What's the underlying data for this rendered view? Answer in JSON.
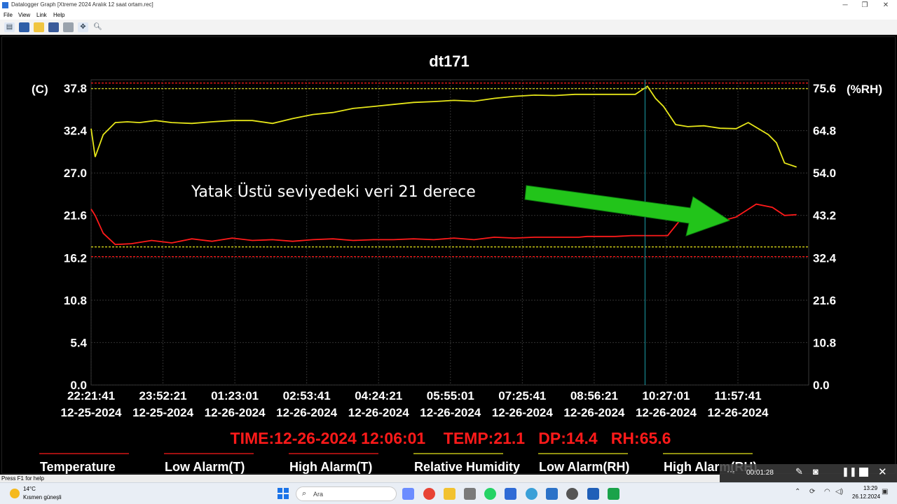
{
  "window": {
    "title": "Datalogger Graph [Xtreme 2024 Aralık 12 saat ortam.rec]",
    "minimize_glyph": "─",
    "maximize_glyph": "❐",
    "close_glyph": "✕"
  },
  "menu": [
    "File",
    "View",
    "Link",
    "Help"
  ],
  "toolbar_icons": [
    "new-icon",
    "screen-icon",
    "open-icon",
    "save-icon",
    "print-icon",
    "fit-icon",
    "zoom-icon"
  ],
  "annotation": {
    "text": "Yatak Üstü seviyedeki veri 21 derece",
    "arrow_color": "#22c41a"
  },
  "chart_data": {
    "type": "line",
    "title": "dt171",
    "left_axis_unit": "(C)",
    "right_axis_unit": "(%RH)",
    "left_ticks": [
      "37.8",
      "32.4",
      "27.0",
      "21.6",
      "16.2",
      "10.8",
      "5.4",
      "0.0"
    ],
    "right_ticks": [
      "75.6",
      "64.8",
      "54.0",
      "43.2",
      "32.4",
      "21.6",
      "10.8",
      "0.0"
    ],
    "x_ticks": [
      {
        "time": "22:21:41",
        "date": "12-25-2024"
      },
      {
        "time": "23:52:21",
        "date": "12-25-2024"
      },
      {
        "time": "01:23:01",
        "date": "12-26-2024"
      },
      {
        "time": "02:53:41",
        "date": "12-26-2024"
      },
      {
        "time": "04:24:21",
        "date": "12-26-2024"
      },
      {
        "time": "05:55:01",
        "date": "12-26-2024"
      },
      {
        "time": "07:25:41",
        "date": "12-26-2024"
      },
      {
        "time": "08:56:21",
        "date": "12-26-2024"
      },
      {
        "time": "10:27:01",
        "date": "12-26-2024"
      },
      {
        "time": "11:57:41",
        "date": "12-26-2024"
      }
    ],
    "ylim_left": [
      0,
      37.8
    ],
    "ylim_right": [
      0,
      75.6
    ],
    "grid": true,
    "series": [
      {
        "name": "Temperature",
        "axis": "left",
        "color": "#ff1a1a",
        "x_hours": [
          0,
          0.1,
          0.3,
          0.6,
          1.0,
          1.5,
          2.0,
          2.5,
          3.0,
          3.5,
          4.0,
          4.5,
          5.0,
          5.5,
          6.0,
          6.5,
          7.0,
          7.5,
          8.0,
          8.5,
          9.0,
          9.5,
          10.0,
          10.5,
          11.0,
          11.5,
          12.0,
          12.1,
          12.3,
          12.6,
          13.0,
          13.4,
          13.8,
          14.3,
          14.8,
          15.2,
          15.5,
          15.7,
          16.0,
          16.5,
          16.9,
          17.2,
          17.5
        ],
        "values": [
          21.8,
          21.0,
          18.8,
          17.4,
          17.5,
          17.9,
          17.6,
          18.1,
          17.8,
          18.2,
          17.9,
          18.0,
          17.8,
          18.0,
          18.1,
          17.9,
          18.0,
          18.0,
          18.1,
          18.0,
          18.2,
          18.0,
          18.3,
          18.2,
          18.3,
          18.3,
          18.3,
          18.3,
          18.4,
          18.4,
          18.4,
          18.5,
          18.5,
          18.5,
          21.6,
          22.2,
          21.1,
          20.4,
          20.8,
          22.4,
          22.0,
          21.0,
          21.1
        ]
      },
      {
        "name": "Relative Humidity",
        "axis": "right",
        "color": "#e6e619",
        "x_hours": [
          0,
          0.1,
          0.3,
          0.6,
          0.9,
          1.2,
          1.6,
          2.0,
          2.5,
          3.0,
          3.5,
          4.0,
          4.5,
          5.0,
          5.5,
          6.0,
          6.5,
          7.0,
          7.5,
          8.0,
          8.5,
          9.0,
          9.5,
          10.0,
          10.5,
          11.0,
          11.5,
          12.0,
          12.5,
          13.0,
          13.5,
          13.8,
          14.0,
          14.2,
          14.5,
          14.8,
          15.2,
          15.6,
          16.0,
          16.3,
          16.8,
          17.0,
          17.2,
          17.5
        ],
        "values": [
          63.5,
          56.5,
          62.0,
          65.0,
          65.2,
          65.0,
          65.5,
          65.0,
          64.8,
          65.2,
          65.5,
          65.5,
          64.8,
          66.0,
          67.0,
          67.5,
          68.5,
          69.0,
          69.5,
          70.0,
          70.2,
          70.5,
          70.3,
          71.0,
          71.5,
          71.8,
          71.7,
          72.0,
          72.0,
          72.0,
          72.0,
          74.0,
          71.0,
          69.0,
          64.5,
          64.0,
          64.2,
          63.6,
          63.5,
          65.0,
          62.0,
          60.0,
          55.0,
          54.0
        ]
      },
      {
        "name": "Low Alarm(T)",
        "axis": "left",
        "color": "#e6e619",
        "values": [
          17.1
        ]
      },
      {
        "name": "High Alarm(T)",
        "axis": "left",
        "color": "#e6e619",
        "values": [
          36.7
        ]
      },
      {
        "name": "Relative Humidity limits",
        "axis": "left",
        "color": "#ff1a1a",
        "values": [
          15.9,
          37.4
        ]
      }
    ],
    "cursor": {
      "x_hours": 13.74,
      "readout": "TIME:12-26-2024 12:06:01    TEMP:21.1   DP:14.4   RH:65.6"
    },
    "legend": {
      "placement": "bottom",
      "items": [
        {
          "label": "Temperature",
          "color": "#ff1a1a"
        },
        {
          "label": "Low Alarm(T)",
          "color": "#ff1a1a"
        },
        {
          "label": "High Alarm(T)",
          "color": "#ff1a1a"
        },
        {
          "label": "Relative Humidity",
          "color": "#e6e619"
        },
        {
          "label": "Low Alarm(RH)",
          "color": "#e6e619"
        },
        {
          "label": "High Alarm(RH)",
          "color": "#e6e619"
        }
      ]
    }
  },
  "hud": {
    "dots": "···",
    "timer": "00:01:28",
    "icons": [
      "pen-icon",
      "camera-icon",
      "pause-icon",
      "stop-icon",
      "close-icon"
    ]
  },
  "status_text": "Press F1 for help",
  "taskbar": {
    "weather_temp": "14°C",
    "weather_desc": "Kısmen güneşli",
    "search_placeholder": "Ara",
    "time": "13:29",
    "date": "26.12.2024"
  }
}
